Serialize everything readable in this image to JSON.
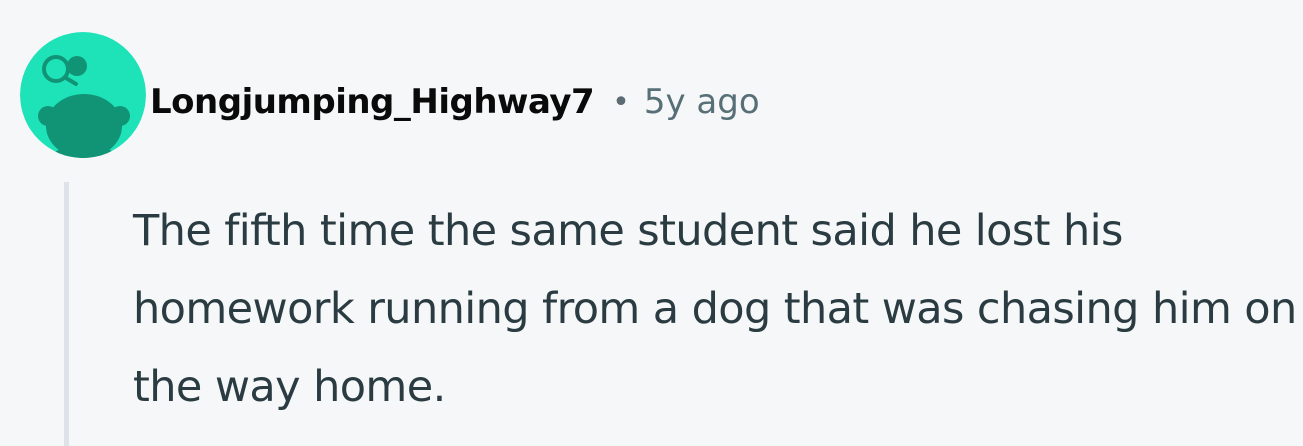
{
  "comment": {
    "author": "Longjumping_Highway7",
    "separator": "•",
    "timestamp": "5y ago",
    "body": "The fifth time the same student said he lost his homework running from a dog that was chasing him on the way home."
  },
  "avatar": {
    "icon": "reddit-snoo-icon",
    "background_color": "#1ee3b9",
    "figure_color": "#119476"
  }
}
